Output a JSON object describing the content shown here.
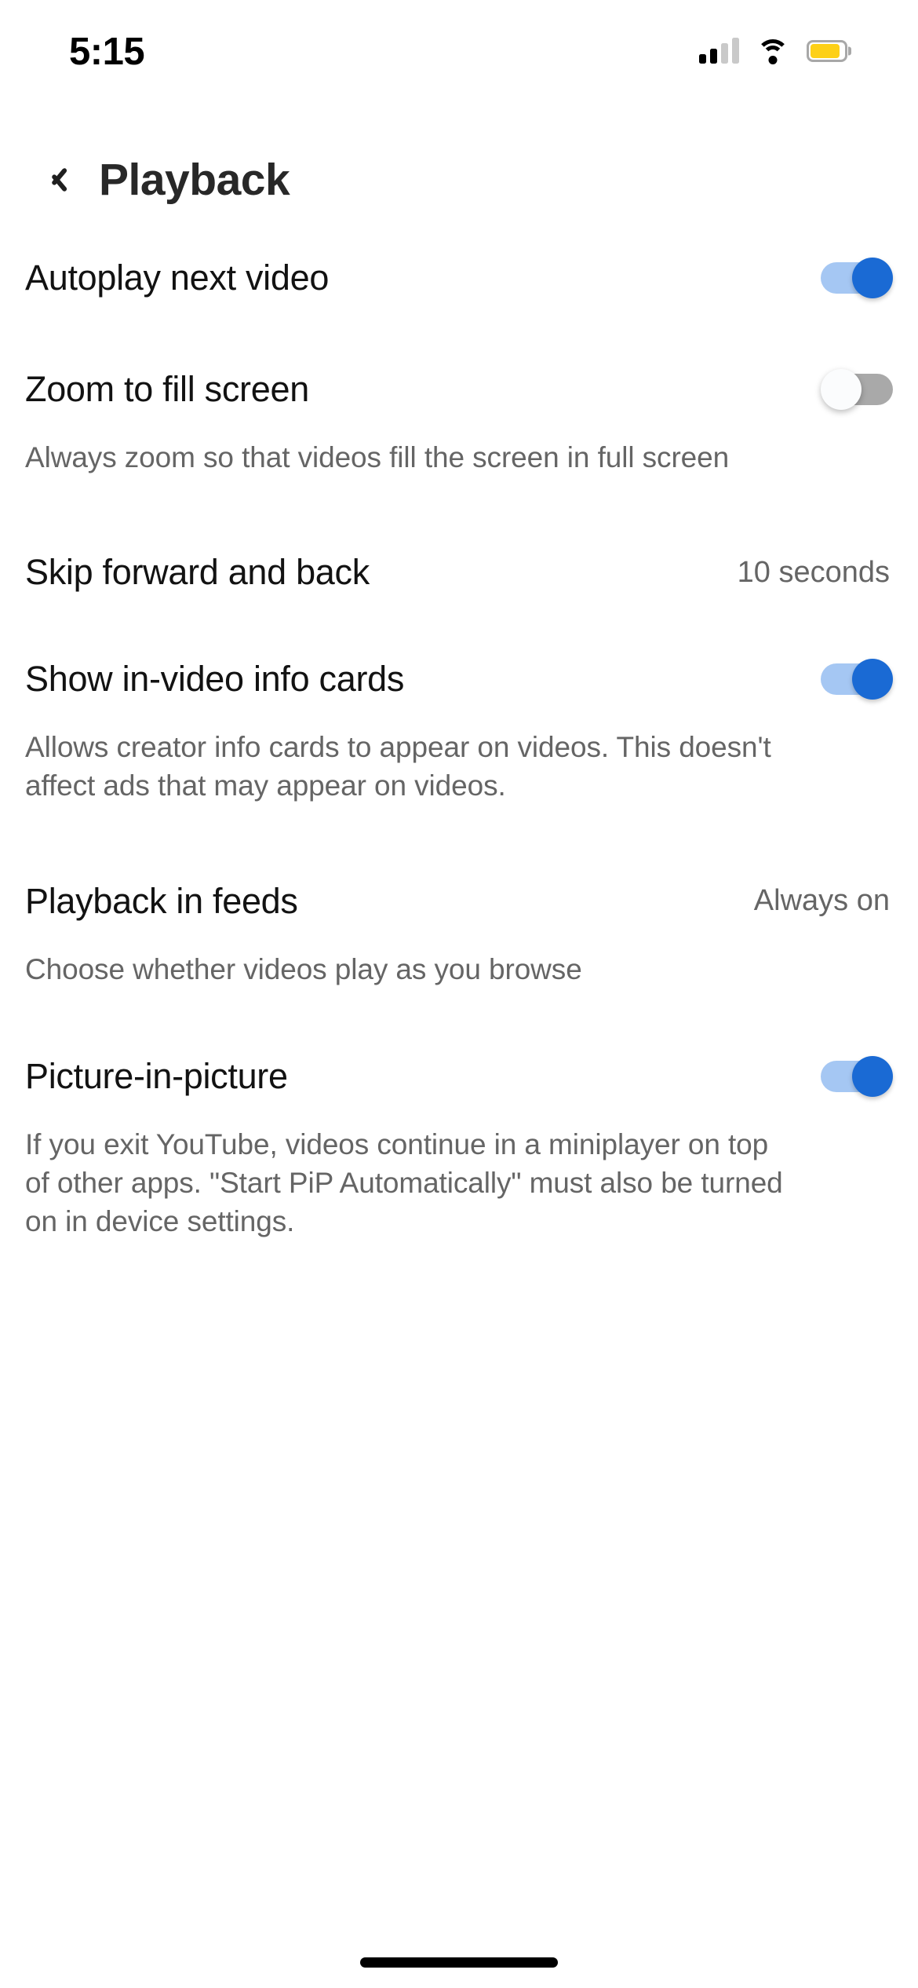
{
  "status_bar": {
    "time": "5:15",
    "signal_icon": "cellular-signal-icon",
    "signal_bars_filled": 2,
    "signal_bars_total": 4,
    "wifi_icon": "wifi-icon",
    "battery_icon": "battery-icon",
    "battery_color": "#fdd017",
    "battery_level_percent": 88
  },
  "header": {
    "back_icon": "chevron-left-icon",
    "title": "Playback"
  },
  "colors": {
    "toggle_on_track": "#a5c7f3",
    "toggle_on_thumb": "#1a6ad4",
    "toggle_off_track": "#a9a9a9",
    "toggle_off_thumb": "#fbfcfd",
    "primary_text": "#121212",
    "secondary_text": "#656565"
  },
  "settings": {
    "autoplay": {
      "label": "Autoplay next video",
      "toggle_state": "on"
    },
    "zoom_fill": {
      "label": "Zoom to fill screen",
      "description": "Always zoom so that videos fill the screen in full screen",
      "toggle_state": "off"
    },
    "skip": {
      "label": "Skip forward and back",
      "value": "10 seconds"
    },
    "info_cards": {
      "label": "Show in-video info cards",
      "description": "Allows creator info cards to appear on videos. This doesn't affect ads that may appear on videos.",
      "toggle_state": "on"
    },
    "playback_feeds": {
      "label": "Playback in feeds",
      "value": "Always on",
      "description": "Choose whether videos play as you browse"
    },
    "pip": {
      "label": "Picture-in-picture",
      "description": "If you exit YouTube, videos continue in a miniplayer on top of other apps. \"Start PiP Automatically\" must also be turned on in device settings.",
      "toggle_state": "on"
    }
  },
  "home_indicator": "home-indicator-bar"
}
